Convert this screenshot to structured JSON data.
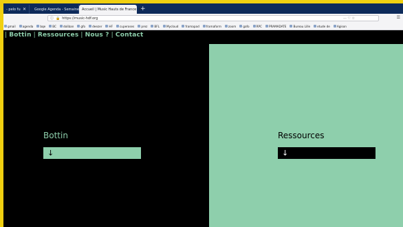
{
  "browser": {
    "tabs": [
      {
        "label": "- pelo fu"
      },
      {
        "label": "Google Agenda - Semaine du"
      },
      {
        "label": "Accueil | Music Hauts de France"
      }
    ],
    "new_tab": "+",
    "url": "https://music-hdf.org",
    "url_actions": "··· ♡ ☆",
    "bookmarks": [
      "gmail",
      "agenda",
      "bqe",
      "BC",
      "doliban",
      "gfo",
      "deezer",
      "HF",
      "cuperoses",
      "prez",
      "BFL",
      "Mycloud",
      "framapad",
      "framaform",
      "zoom",
      "gafo",
      "RPC",
      "PRAMADATE",
      "Bureau Lille",
      "etude de",
      "Agison"
    ]
  },
  "site": {
    "nav": [
      "Bottin",
      "Ressources",
      "Nous ?",
      "Contact"
    ],
    "sections": [
      {
        "title": "Bottin",
        "arrow": "↓"
      },
      {
        "title": "Ressources",
        "arrow": "↓"
      }
    ]
  },
  "colors": {
    "accent": "#8ecfac",
    "background": "#000000",
    "frame": "#f0d010"
  }
}
